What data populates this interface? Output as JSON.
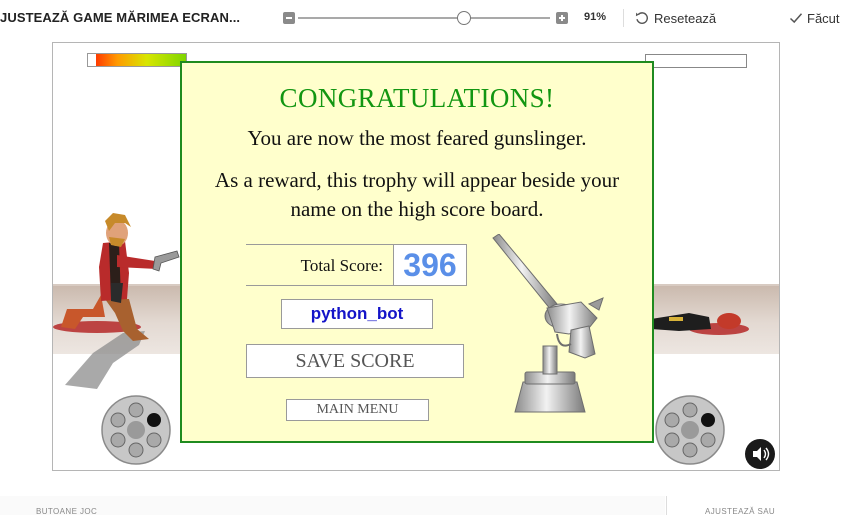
{
  "toolbar": {
    "title": "JUSTEAZĂ GAME MĂRIMEA ECRAN...",
    "zoom_percent": "91%",
    "zoom_level": 0.91,
    "reset_label": "Resetează",
    "done_label": "Făcut"
  },
  "game": {
    "player_health": 1.0,
    "enemy_health": 0.0,
    "dialog": {
      "title": "CONGRATULATIONS!",
      "line1": "You are now the most feared gunslinger.",
      "line2": "As a reward, this trophy will appear beside your name on the high score board.",
      "score_label": "Total Score:",
      "score_value": "396",
      "player_name": "python_bot",
      "save_label": "SAVE SCORE",
      "menu_label": "MAIN MENU"
    },
    "colors": {
      "dialog_background": "#ffffcc",
      "dialog_border": "#1f8b1f",
      "title_color": "#129612",
      "score_color": "#5a8fe8",
      "name_color": "#1414c8"
    }
  },
  "bottom": {
    "left_label": "BUTOANE JOC",
    "right_label": "AJUSTEAZĂ SAU"
  }
}
